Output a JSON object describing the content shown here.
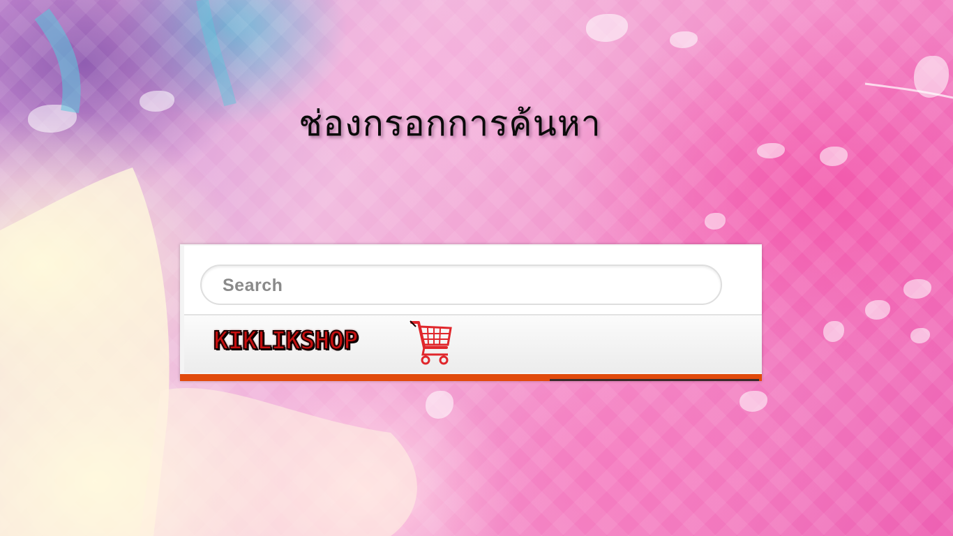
{
  "slide": {
    "title": "ช่องกรอกการค้นหา"
  },
  "search": {
    "placeholder": "Search"
  },
  "logo": {
    "text": "KIKLIKSHOP",
    "icon": "shopping-cart-icon"
  },
  "colors": {
    "accent_bar": "#e14a0b",
    "logo_red": "#c51010",
    "cart_red": "#e0262b"
  }
}
